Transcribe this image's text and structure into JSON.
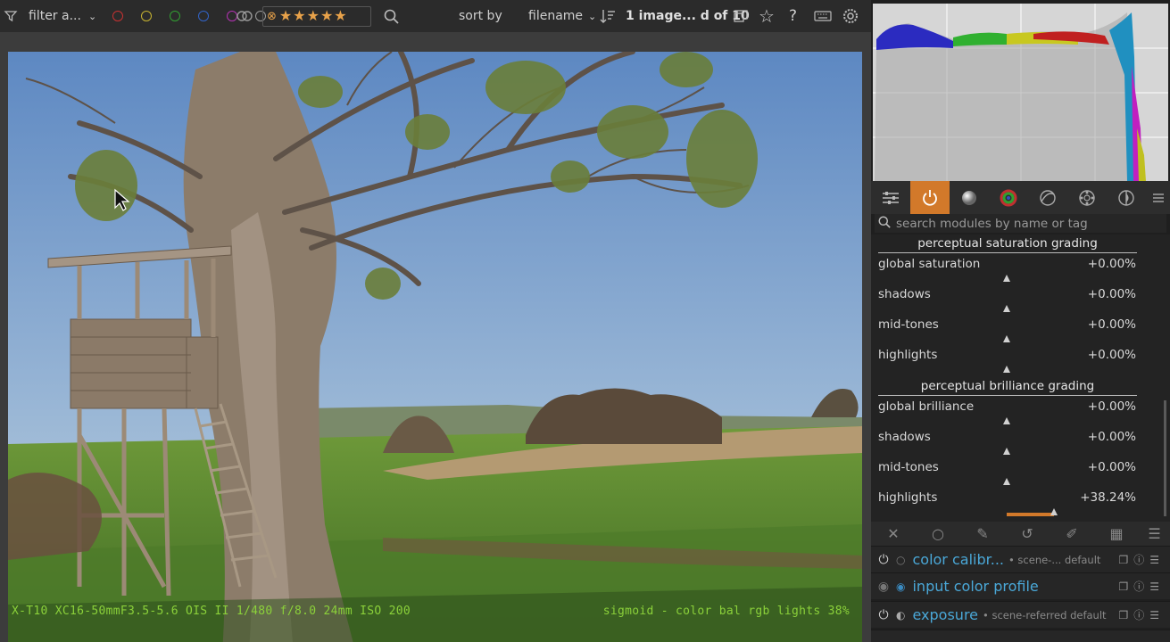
{
  "topbar": {
    "filter_label": "filter a...",
    "sort_label": "sort by",
    "sort_value": "filename",
    "count_text": "1 image... d of",
    "count_total": "10",
    "rating_stars": 5,
    "color_labels": [
      "#c83232",
      "#c8b432",
      "#32a032",
      "#3264c8",
      "#b432b4",
      "#9a9a9a"
    ]
  },
  "overlay": {
    "left_text": "X-T10 XC16-50mmF3.5-5.6 OIS II    1/480 f/8.0 24mm ISO 200",
    "right_text": "sigmoid - color bal rgb lights 38%"
  },
  "right_panel": {
    "search_placeholder": "search modules by name or tag",
    "saturation_header": "perceptual saturation grading",
    "saturation_rows": [
      {
        "label": "global saturation",
        "value": "+0.00%"
      },
      {
        "label": "shadows",
        "value": "+0.00%"
      },
      {
        "label": "mid-tones",
        "value": "+0.00%"
      },
      {
        "label": "highlights",
        "value": "+0.00%"
      }
    ],
    "brilliance_header": "perceptual brilliance grading",
    "brilliance_rows": [
      {
        "label": "global brilliance",
        "value": "+0.00%"
      },
      {
        "label": "shadows",
        "value": "+0.00%"
      },
      {
        "label": "mid-tones",
        "value": "+0.00%"
      },
      {
        "label": "highlights",
        "value": "+38.24%",
        "fraction": 0.38
      }
    ],
    "modules": [
      {
        "name": "color calibr...",
        "sub": "• scene-... default"
      },
      {
        "name": "input color profile",
        "sub": ""
      },
      {
        "name": "exposure",
        "sub": "• scene-referred default"
      }
    ],
    "accent": "#d2792a"
  }
}
